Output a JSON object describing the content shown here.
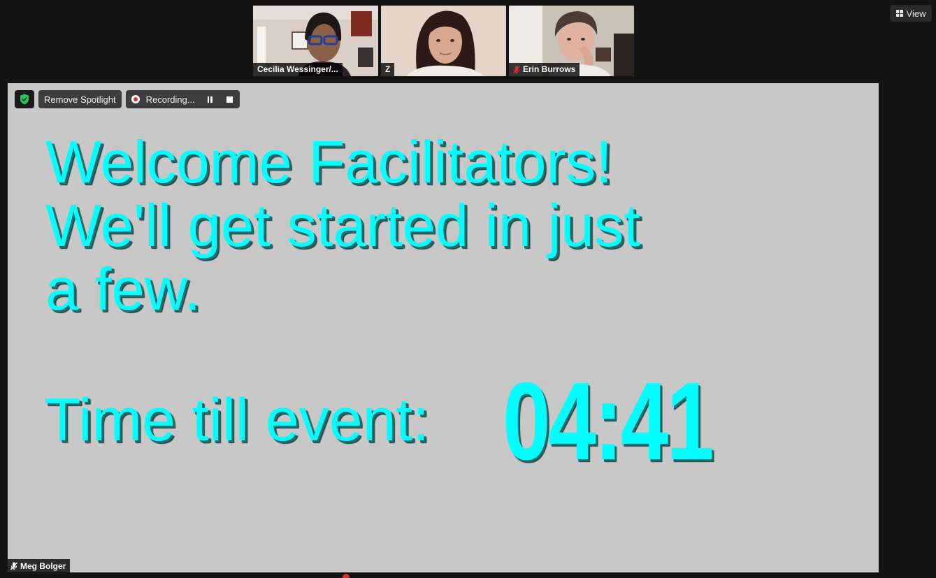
{
  "participants": [
    {
      "name": "Cecilia Wessinger/...",
      "muted": false
    },
    {
      "name": "Z",
      "muted": false
    },
    {
      "name": "Erin Burrows",
      "muted": true
    }
  ],
  "view_button": {
    "label": "View",
    "icon": "grid-icon"
  },
  "share_toolbar": {
    "security_icon": "shield-check-icon",
    "remove_spotlight_label": "Remove Spotlight",
    "recording_label": "Recording...",
    "pause_icon": "pause-icon",
    "stop_icon": "stop-icon"
  },
  "slide": {
    "line1": "Welcome Facilitators!",
    "line2": "We'll get started in just",
    "line3": "a few.",
    "countdown_label": "Time till event:",
    "countdown_value": "04:41",
    "text_color": "#00ffff",
    "background": "#c8c8c8"
  },
  "active_speaker": {
    "name": "Meg Bolger",
    "muted": true
  }
}
